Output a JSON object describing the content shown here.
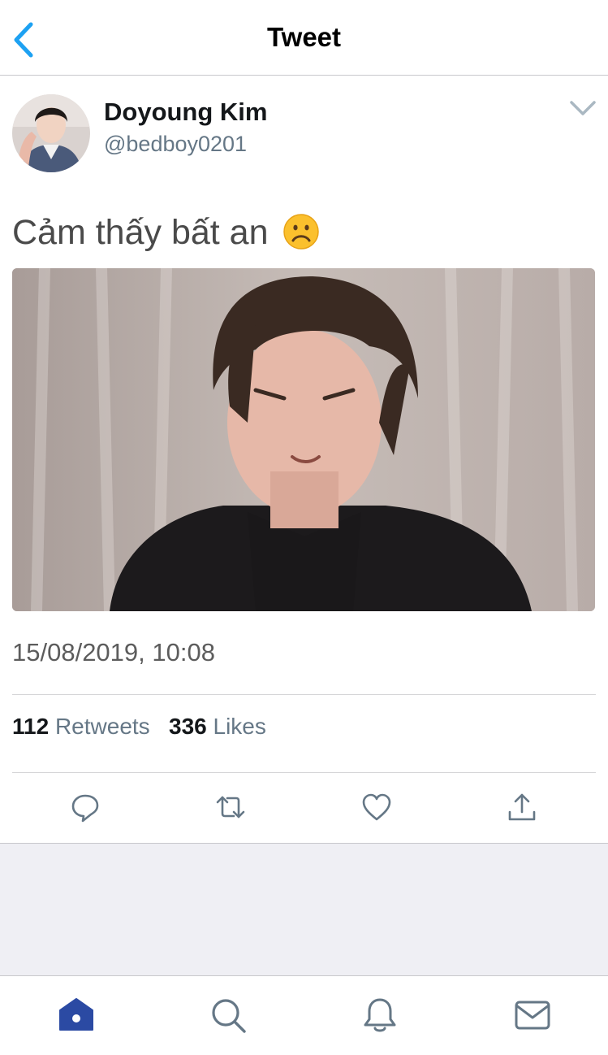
{
  "header": {
    "title": "Tweet"
  },
  "tweet": {
    "author": {
      "name": "Doyoung Kim",
      "handle": "@bedboy0201"
    },
    "text": "Cảm thấy bất an",
    "emoji": "frowning-face",
    "timestamp": "15/08/2019, 10:08",
    "stats": {
      "retweets_count": "112",
      "retweets_label": "Retweets",
      "likes_count": "336",
      "likes_label": "Likes"
    }
  },
  "actions": [
    "reply",
    "retweet",
    "like",
    "share"
  ],
  "tabbar": {
    "items": [
      "home",
      "search",
      "notifications",
      "messages"
    ],
    "active": "home"
  },
  "colors": {
    "accent": "#1da1f2",
    "active_tab": "#2b4aa3",
    "secondary_text": "#657786",
    "icon_gray": "#657786"
  }
}
